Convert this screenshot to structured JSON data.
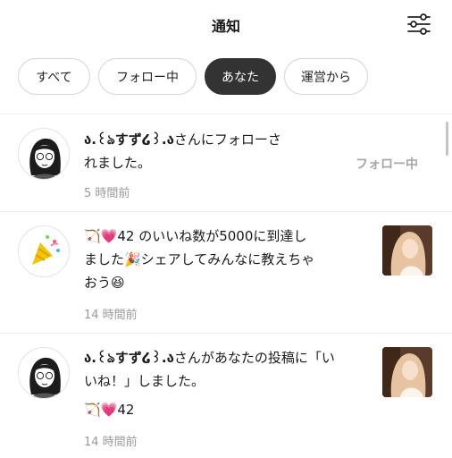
{
  "header": {
    "title": "通知",
    "settings_icon": "sliders-icon"
  },
  "tabs": [
    {
      "label": "すべて",
      "active": false
    },
    {
      "label": "フォロー中",
      "active": false
    },
    {
      "label": "あなた",
      "active": true
    },
    {
      "label": "運営から",
      "active": false
    }
  ],
  "notifications": [
    {
      "avatar": "user-avatar-manga-girl",
      "user_name": "ა.꒰ঌすず໒꒱.ა",
      "line1_suffix": "さんにフォローさ",
      "line2": "れました。",
      "status": "フォロー中",
      "time": "5 時間前"
    },
    {
      "avatar": "party-popper-icon",
      "line1": "🏹💗42 のいいね数が5000に到達し",
      "line2": "ました🎉シェアしてみんなに教えちゃ",
      "line3": "おう😆",
      "time": "14 時間前",
      "thumbnail": "post-thumbnail"
    },
    {
      "avatar": "user-avatar-manga-girl",
      "user_name": "ა.꒰ঌすず໒꒱.ა",
      "line1_suffix": "さんがあなたの投稿に「い",
      "line2": "いね！」しました。",
      "line3": "🏹💗42",
      "time": "14 時間前",
      "thumbnail": "post-thumbnail"
    }
  ],
  "colors": {
    "accent_tab": "#333333",
    "muted_text": "#9a9a9a",
    "divider": "#ececec"
  }
}
